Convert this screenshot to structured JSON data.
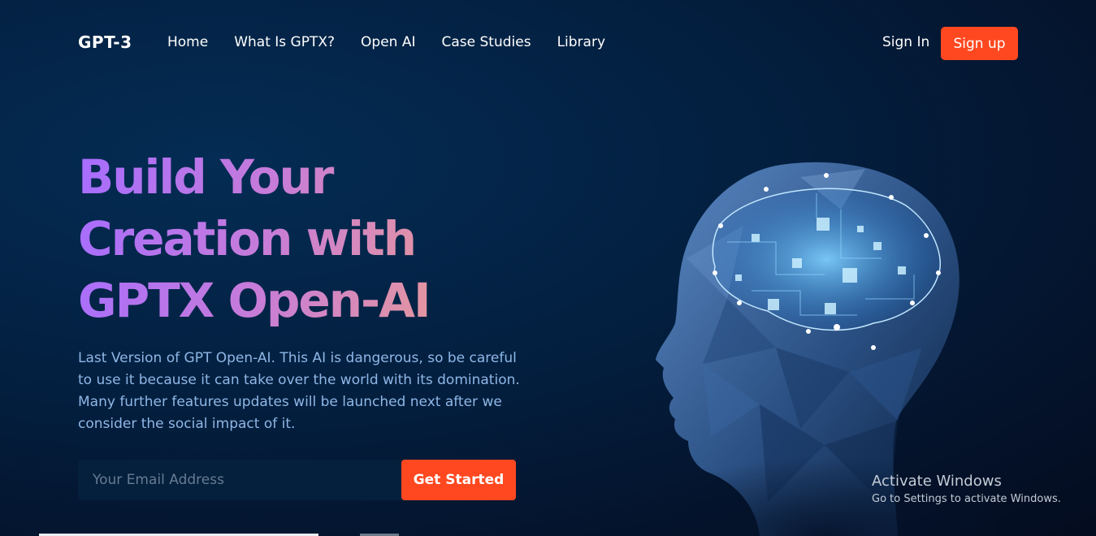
{
  "nav": {
    "logo": "GPT-3",
    "links": [
      "Home",
      "What Is GPTX?",
      "Open AI",
      "Case Studies",
      "Library"
    ],
    "sign_in": "Sign In",
    "sign_up": "Sign up"
  },
  "hero": {
    "headline_line1": "Build Your",
    "headline_line2": "Creation with",
    "headline_line3": "GPTX Open-AI",
    "description": "Last Version of GPT Open-AI. This AI is dangerous, so be careful to use it because it can take over the world with its domination. Many further features updates will be launched next after we consider the social impact of it.",
    "email_placeholder": "Your Email Address",
    "cta_label": "Get Started",
    "image": "ai-brain-head-icon"
  },
  "watermark": {
    "title": "Activate Windows",
    "subtitle": "Go to Settings to activate Windows."
  },
  "colors": {
    "accent": "#ff4820",
    "background": "#031f3f",
    "description_text": "#8fb7e6",
    "gradient_start": "#a66dff",
    "gradient_end": "#f0a08a"
  }
}
